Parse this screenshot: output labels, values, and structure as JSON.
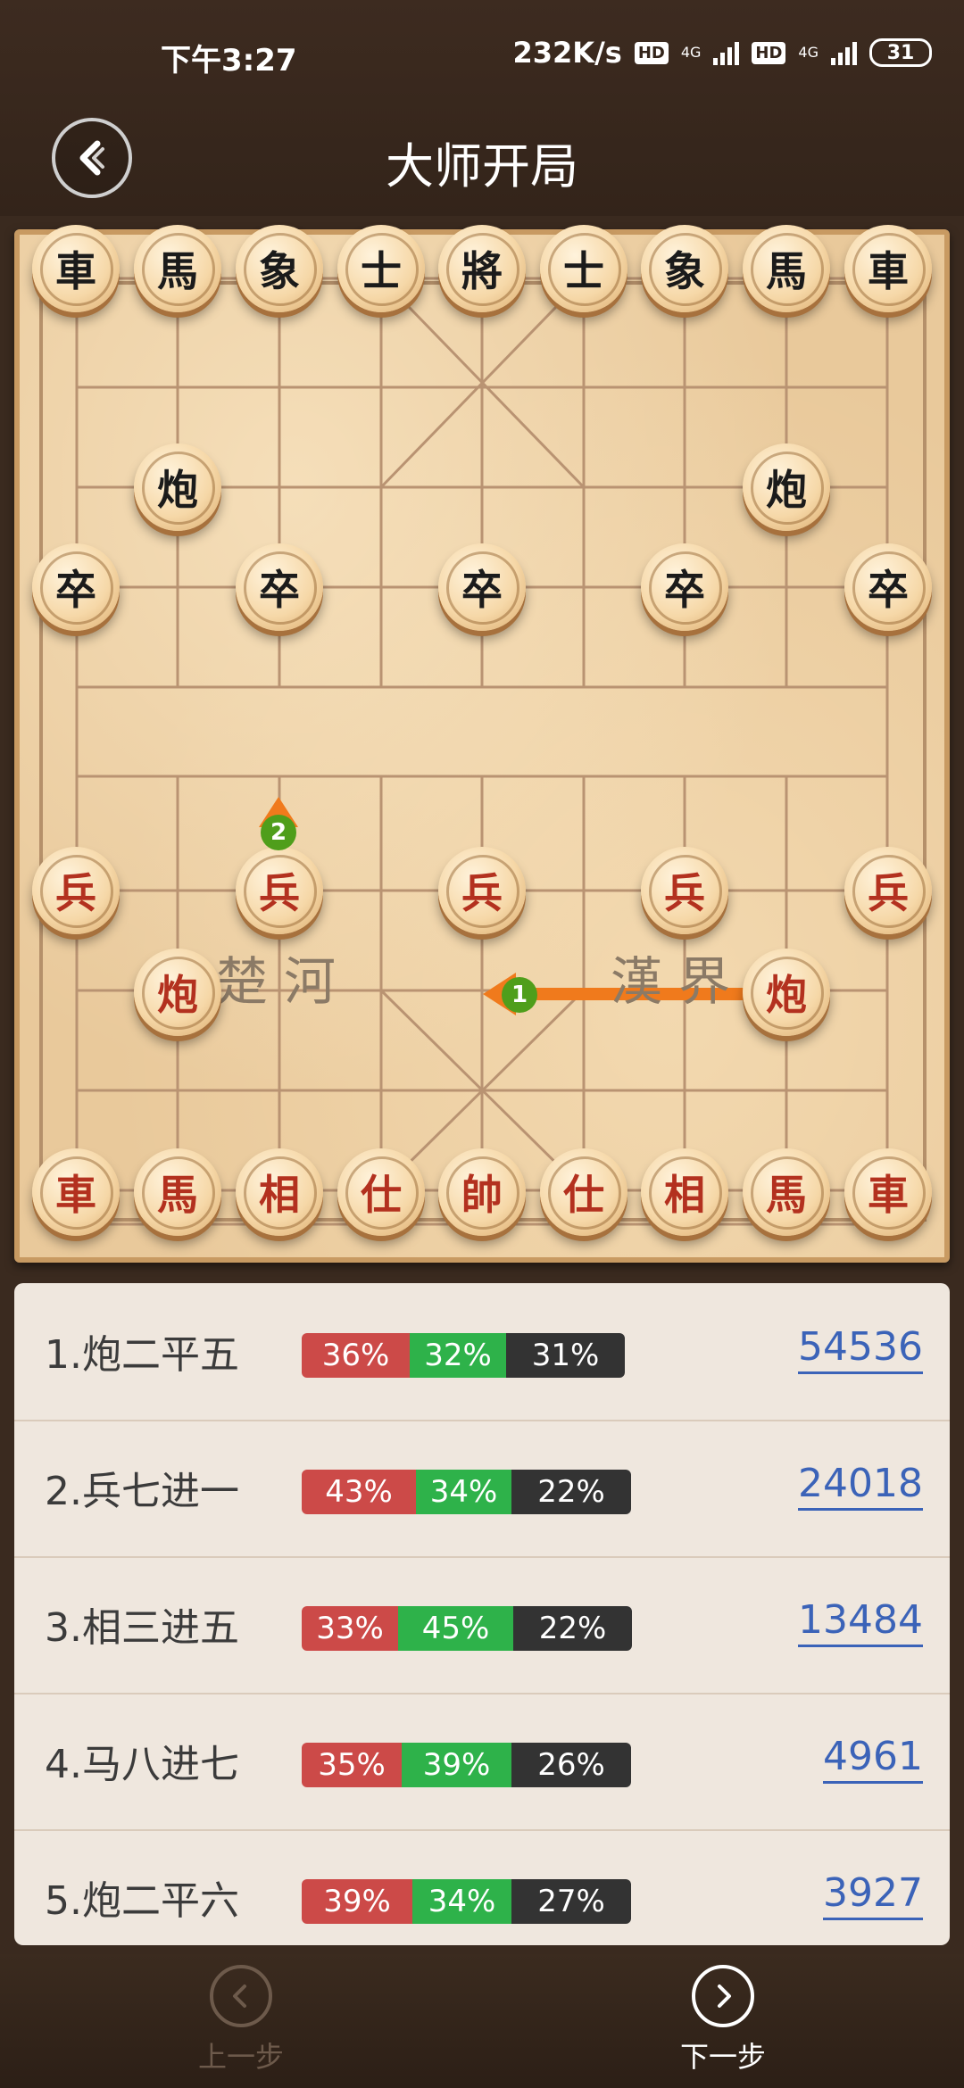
{
  "status_bar": {
    "time": "下午3:27",
    "speed": "232K/s",
    "badge_hd": "HD",
    "network": "4G",
    "battery": "31"
  },
  "header": {
    "title": "大师开局"
  },
  "board": {
    "river_left": "楚河",
    "river_right": "漢界",
    "pieces_top": [
      "車",
      "馬",
      "象",
      "士",
      "將",
      "士",
      "象",
      "馬",
      "車"
    ],
    "cannon_black": "炮",
    "soldier_black": "卒",
    "pieces_bottom": [
      "車",
      "馬",
      "相",
      "仕",
      "帥",
      "仕",
      "相",
      "馬",
      "車"
    ],
    "cannon_red": "炮",
    "soldier_red": "兵",
    "moves": [
      {
        "label": "1",
        "color": "#f07a1c"
      },
      {
        "label": "2",
        "color": "#f07a1c"
      }
    ]
  },
  "openings": [
    {
      "move": "1.炮二平五",
      "red": "36%",
      "green": "32%",
      "dark": "31%",
      "count": "54536"
    },
    {
      "move": "2.兵七进一",
      "red": "43%",
      "green": "34%",
      "dark": "22%",
      "count": "24018"
    },
    {
      "move": "3.相三进五",
      "red": "33%",
      "green": "45%",
      "dark": "22%",
      "count": "13484"
    },
    {
      "move": "4.马八进七",
      "red": "35%",
      "green": "39%",
      "dark": "26%",
      "count": "4961"
    },
    {
      "move": "5.炮二平六",
      "red": "39%",
      "green": "34%",
      "dark": "27%",
      "count": "3927"
    }
  ],
  "bottom_nav": {
    "prev_label": "上一步",
    "next_label": "下一步"
  }
}
